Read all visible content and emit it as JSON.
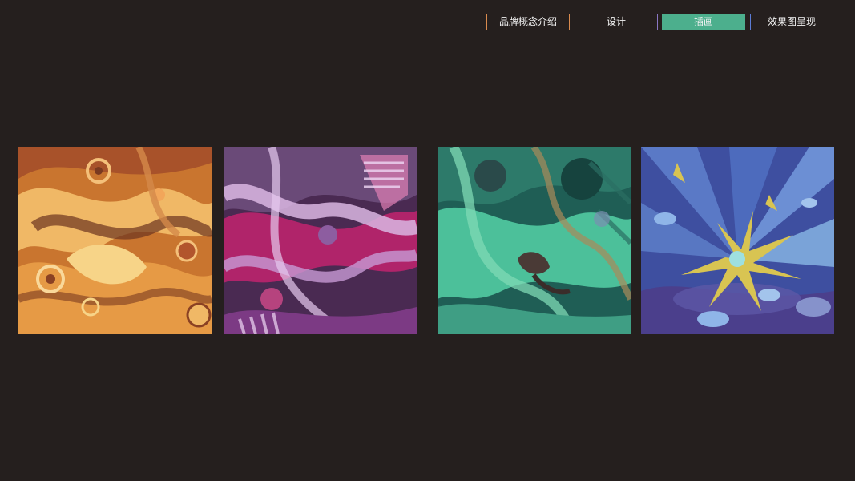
{
  "nav": {
    "tabs": [
      {
        "label": "品牌概念介绍",
        "active": false,
        "border_color": "#d98a4e"
      },
      {
        "label": "设计",
        "active": false,
        "border_color": "#8a76c4"
      },
      {
        "label": "插画",
        "active": true,
        "border_color": "#4caf8d"
      },
      {
        "label": "效果图呈现",
        "active": false,
        "border_color": "#5b7bd4"
      }
    ]
  },
  "gallery": {
    "illustrations": [
      {
        "palette": "orange-swirl"
      },
      {
        "palette": "purple-ribbons"
      },
      {
        "palette": "teal-flow"
      },
      {
        "palette": "blue-burst"
      }
    ]
  },
  "colors": {
    "background": "#251f1e",
    "active_tab": "#4caf8d"
  }
}
